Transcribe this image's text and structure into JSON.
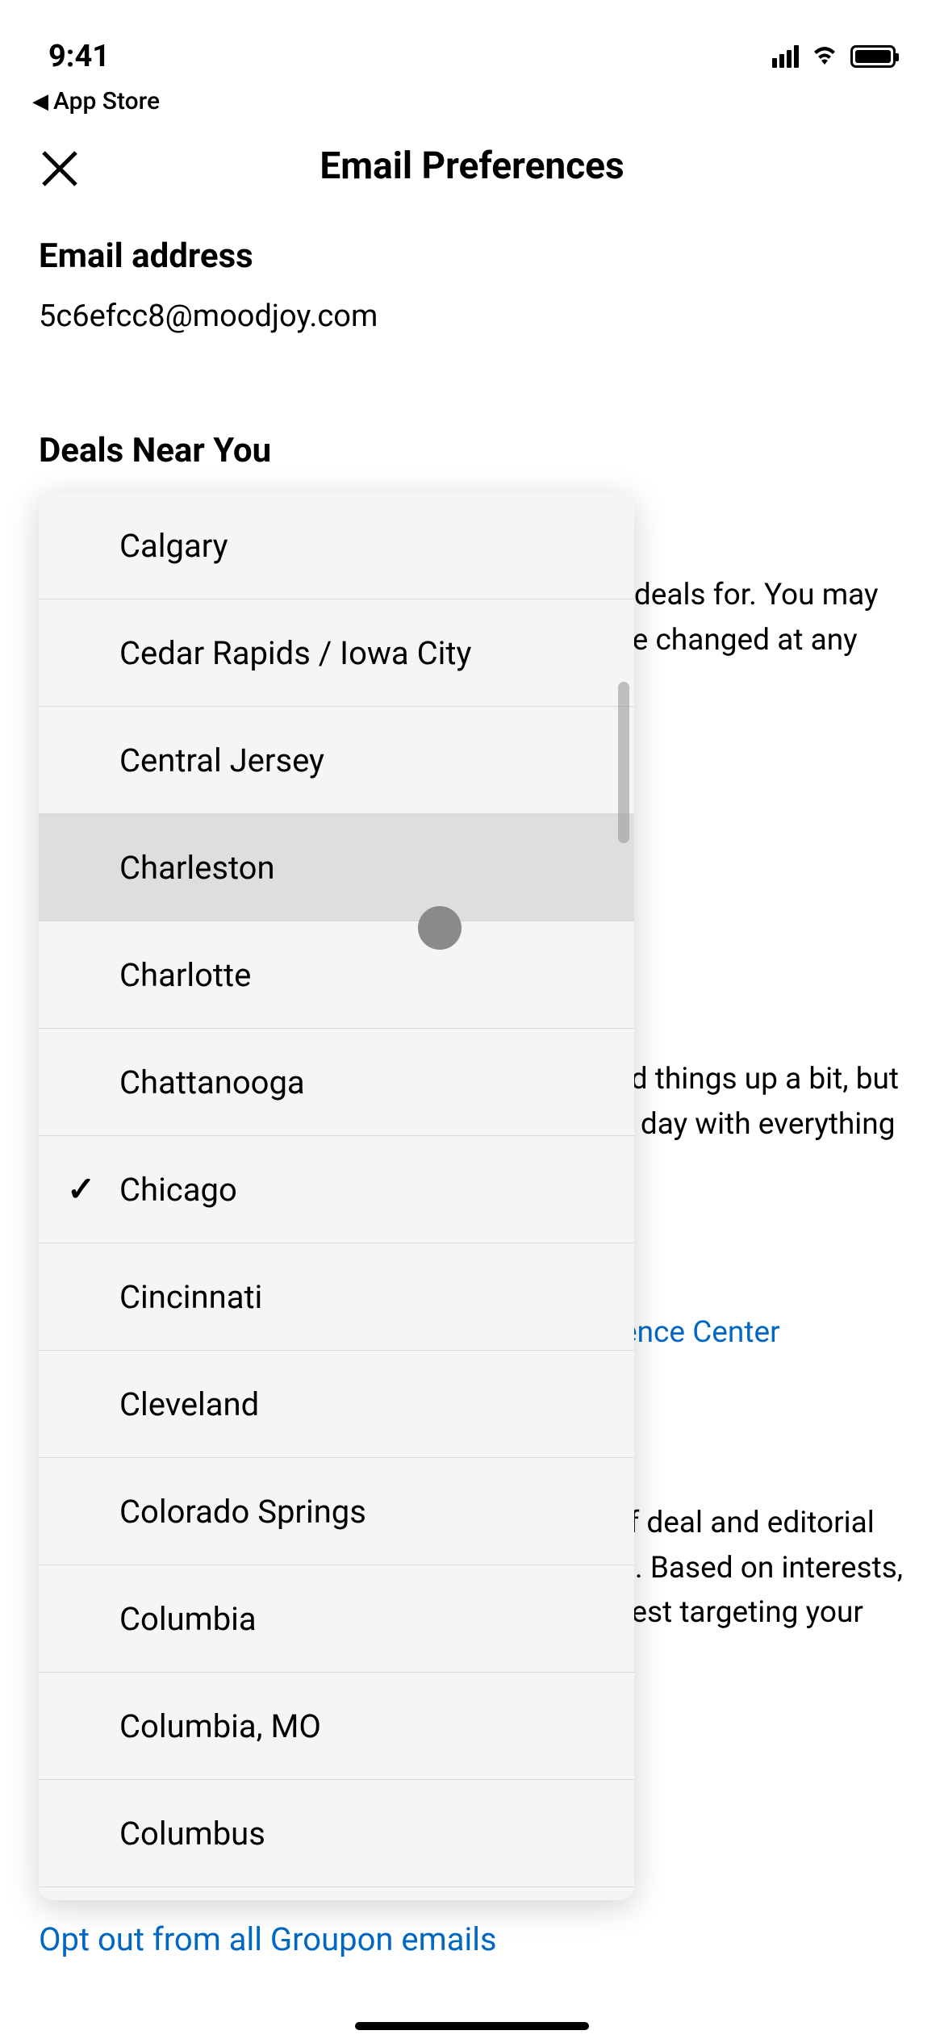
{
  "status": {
    "time": "9:41",
    "back_app_label": "App Store"
  },
  "header": {
    "title": "Email Preferences"
  },
  "email": {
    "label": "Email address",
    "value": "5c6efcc8@moodjoy.com"
  },
  "deals": {
    "heading_partial": "Deals Near You"
  },
  "background_text": {
    "block1": "Let us know which cities you'd like to receive deals for. You may add a second city to your daily email. It can be changed at any time.",
    "block2": "Tell us more about you! We know we switched things up a bit, but we now send you one consolidated email per day with everything relevant to you!",
    "pref_center_link": "ence Center",
    "block3": "Now you can begin personalizing the types of deal and editorial content emails you receive on a regular basis. Based on interests, you will receive curated content we feel are best targeting your needs and desires.",
    "opt_out_link": "Opt out from all Groupon emails"
  },
  "dropdown": {
    "items": [
      {
        "label": "Calgary",
        "selected": false,
        "highlighted": false
      },
      {
        "label": "Cedar Rapids / Iowa City",
        "selected": false,
        "highlighted": false
      },
      {
        "label": "Central Jersey",
        "selected": false,
        "highlighted": false
      },
      {
        "label": "Charleston",
        "selected": false,
        "highlighted": true
      },
      {
        "label": "Charlotte",
        "selected": false,
        "highlighted": false
      },
      {
        "label": "Chattanooga",
        "selected": false,
        "highlighted": false
      },
      {
        "label": "Chicago",
        "selected": true,
        "highlighted": false
      },
      {
        "label": "Cincinnati",
        "selected": false,
        "highlighted": false
      },
      {
        "label": "Cleveland",
        "selected": false,
        "highlighted": false
      },
      {
        "label": "Colorado Springs",
        "selected": false,
        "highlighted": false
      },
      {
        "label": "Columbia",
        "selected": false,
        "highlighted": false
      },
      {
        "label": "Columbia, MO",
        "selected": false,
        "highlighted": false
      },
      {
        "label": "Columbus",
        "selected": false,
        "highlighted": false
      }
    ]
  }
}
